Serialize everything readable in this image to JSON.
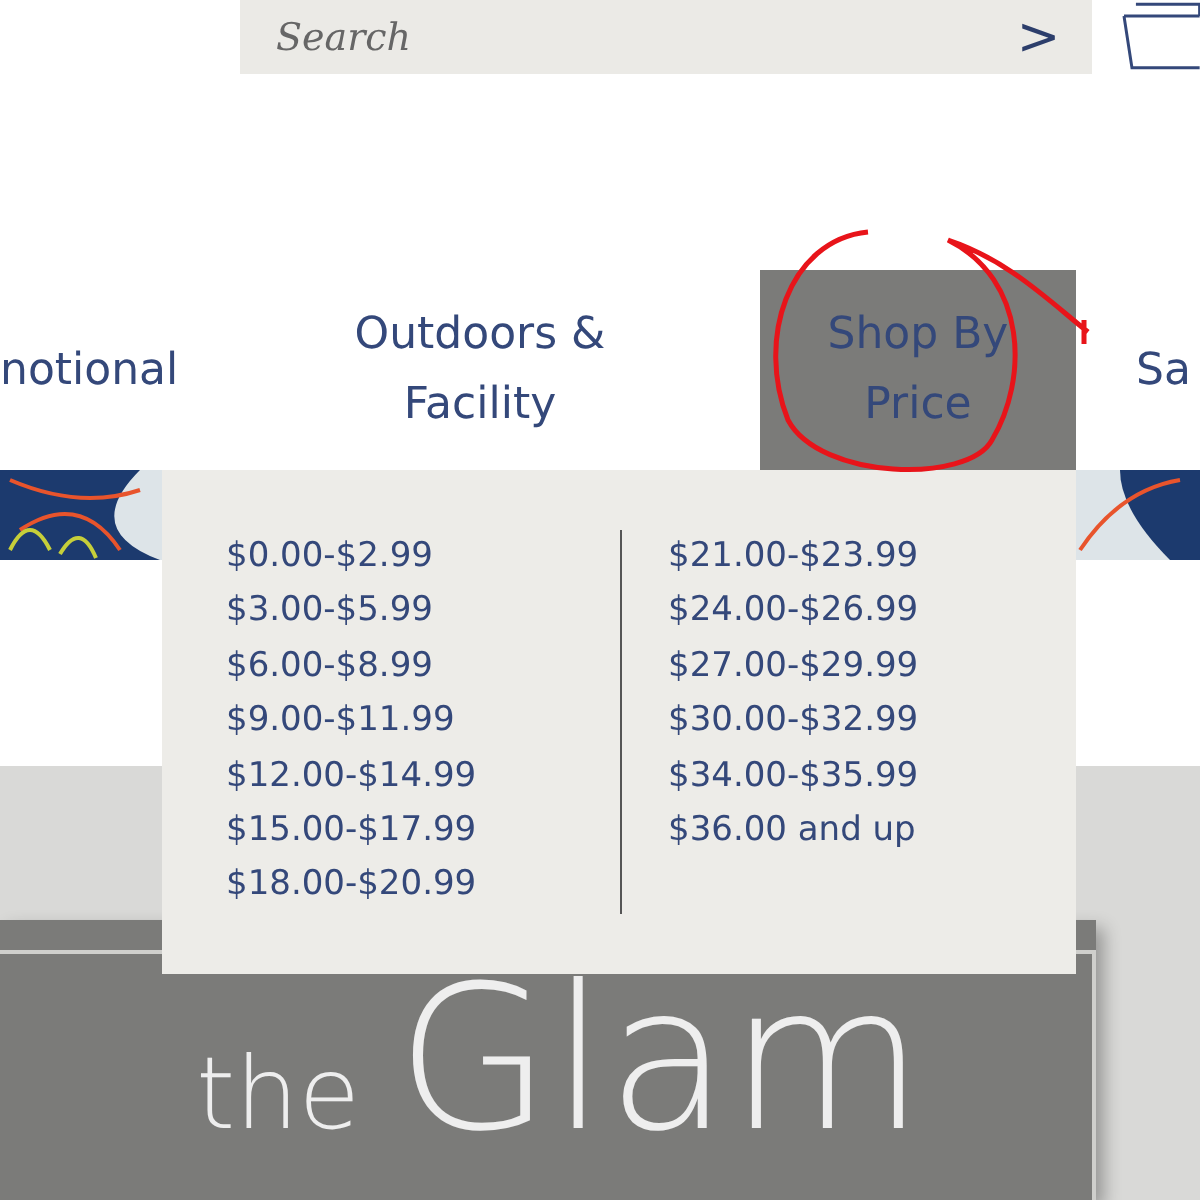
{
  "search": {
    "placeholder": "Search",
    "submit": ">"
  },
  "nav": [
    {
      "label": "notional",
      "selected": false
    },
    {
      "label": "Outdoors & Facility",
      "selected": false
    },
    {
      "label": "Shop By Price",
      "selected": true
    },
    {
      "label": "Sa",
      "selected": false
    }
  ],
  "price_menu": {
    "columns": [
      [
        "$0.00-$2.99",
        "$3.00-$5.99",
        "$6.00-$8.99",
        "$9.00-$11.99",
        "$12.00-$14.99",
        "$15.00-$17.99",
        "$18.00-$20.99"
      ],
      [
        "$21.00-$23.99",
        "$24.00-$26.99",
        "$27.00-$29.99",
        "$30.00-$32.99",
        "$34.00-$35.99",
        "$36.00 and up"
      ]
    ]
  },
  "promo": {
    "small": "the",
    "large": "Glam"
  }
}
